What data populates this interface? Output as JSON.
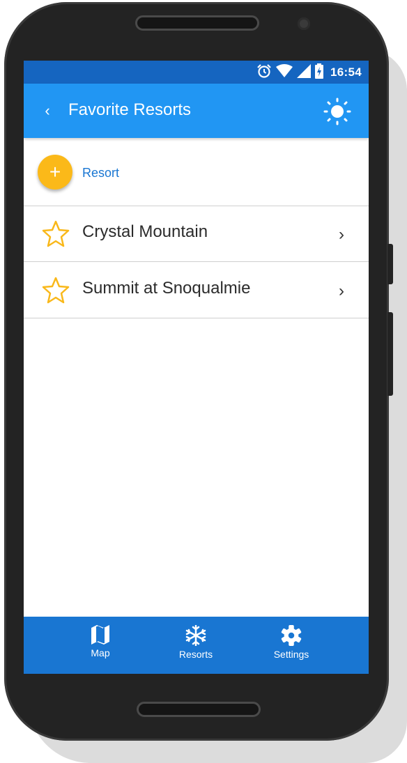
{
  "status": {
    "time": "16:54"
  },
  "appbar": {
    "back_glyph": "‹",
    "title": "Favorite Resorts",
    "action_icon": "brightness-icon"
  },
  "add": {
    "glyph": "+",
    "label": "Resort"
  },
  "resorts": [
    {
      "name": "Crystal Mountain",
      "icon": "star-outline-icon",
      "chevron": "›"
    },
    {
      "name": "Summit at Snoqualmie",
      "icon": "star-outline-icon",
      "chevron": "›"
    }
  ],
  "nav": {
    "items": [
      {
        "label": "Map",
        "icon": "map-icon"
      },
      {
        "label": "Resorts",
        "icon": "snowflake-icon"
      },
      {
        "label": "Settings",
        "icon": "gear-icon"
      }
    ]
  },
  "colors": {
    "status_bar": "#1565c0",
    "app_bar": "#2196f3",
    "bottom_nav": "#1976d2",
    "accent": "#fbb919",
    "link": "#1976d2"
  }
}
